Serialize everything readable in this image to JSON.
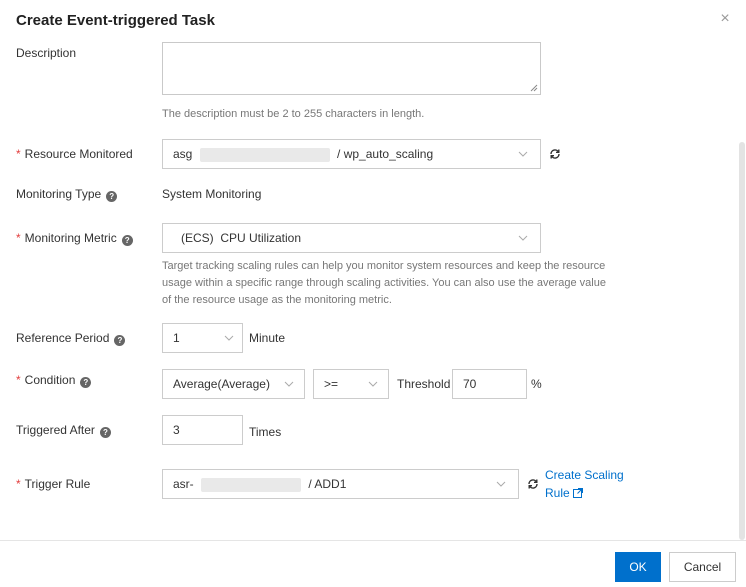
{
  "dialog": {
    "title": "Create Event-triggered Task",
    "close_glyph": "×"
  },
  "description": {
    "label": "Description",
    "value": "",
    "hint": "The description must be 2 to 255 characters in length."
  },
  "resource_monitored": {
    "label": "Resource Monitored",
    "value_prefix": "asg",
    "value_suffix": "/ wp_auto_scaling",
    "icon": "refresh-icon"
  },
  "monitoring_type": {
    "label": "Monitoring Type",
    "value": "System Monitoring"
  },
  "monitoring_metric": {
    "label": "Monitoring Metric",
    "value": "(ECS)  CPU Utilization",
    "hint_lines": [
      "Target tracking scaling rules can help you monitor system resources and keep the resource",
      "usage within a specific range through scaling activities. You can also use the average value",
      "of the resource usage as the monitoring metric."
    ]
  },
  "reference_period": {
    "label": "Reference Period",
    "value": "1",
    "unit": "Minute"
  },
  "condition": {
    "label": "Condition",
    "statistic": "Average(Average)",
    "operator": ">=",
    "threshold_label": "Threshold",
    "threshold": "70",
    "unit": "%"
  },
  "triggered_after": {
    "label": "Triggered After",
    "value": "3",
    "unit": "Times"
  },
  "trigger_rule": {
    "label": "Trigger Rule",
    "value_prefix": "asr-",
    "value_suffix": "/ ADD1",
    "link_line1": "Create Scaling",
    "link_line2": "Rule"
  },
  "footer": {
    "ok_label": "OK",
    "cancel_label": "Cancel"
  },
  "colors": {
    "primary": "#0070cc",
    "required": "#e23d3d"
  }
}
